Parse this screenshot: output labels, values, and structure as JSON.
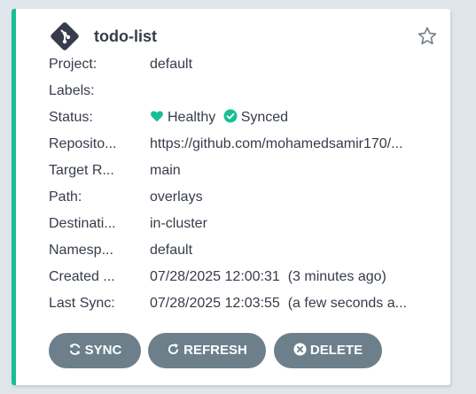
{
  "app": {
    "name": "todo-list"
  },
  "fields": [
    {
      "label": "Project:",
      "value": "default"
    },
    {
      "label": "Labels:",
      "value": ""
    },
    {
      "label": "Status:",
      "health": "Healthy",
      "sync": "Synced"
    },
    {
      "label": "Reposito...",
      "value": "https://github.com/mohamedsamir170/..."
    },
    {
      "label": "Target R...",
      "value": "main"
    },
    {
      "label": "Path:",
      "value": "overlays"
    },
    {
      "label": "Destinati...",
      "value": "in-cluster"
    },
    {
      "label": "Namesp...",
      "value": "default"
    },
    {
      "label": "Created ...",
      "value": "07/28/2025 12:00:31  (3 minutes ago)"
    },
    {
      "label": "Last Sync:",
      "value": "07/28/2025 12:03:55  (a few seconds a..."
    }
  ],
  "actions": {
    "sync": "SYNC",
    "refresh": "REFRESH",
    "delete": "DELETE"
  },
  "colors": {
    "accent": "#18be94",
    "healthy": "#18be94",
    "button": "#6d7f8b",
    "background": "#dee6eb"
  }
}
